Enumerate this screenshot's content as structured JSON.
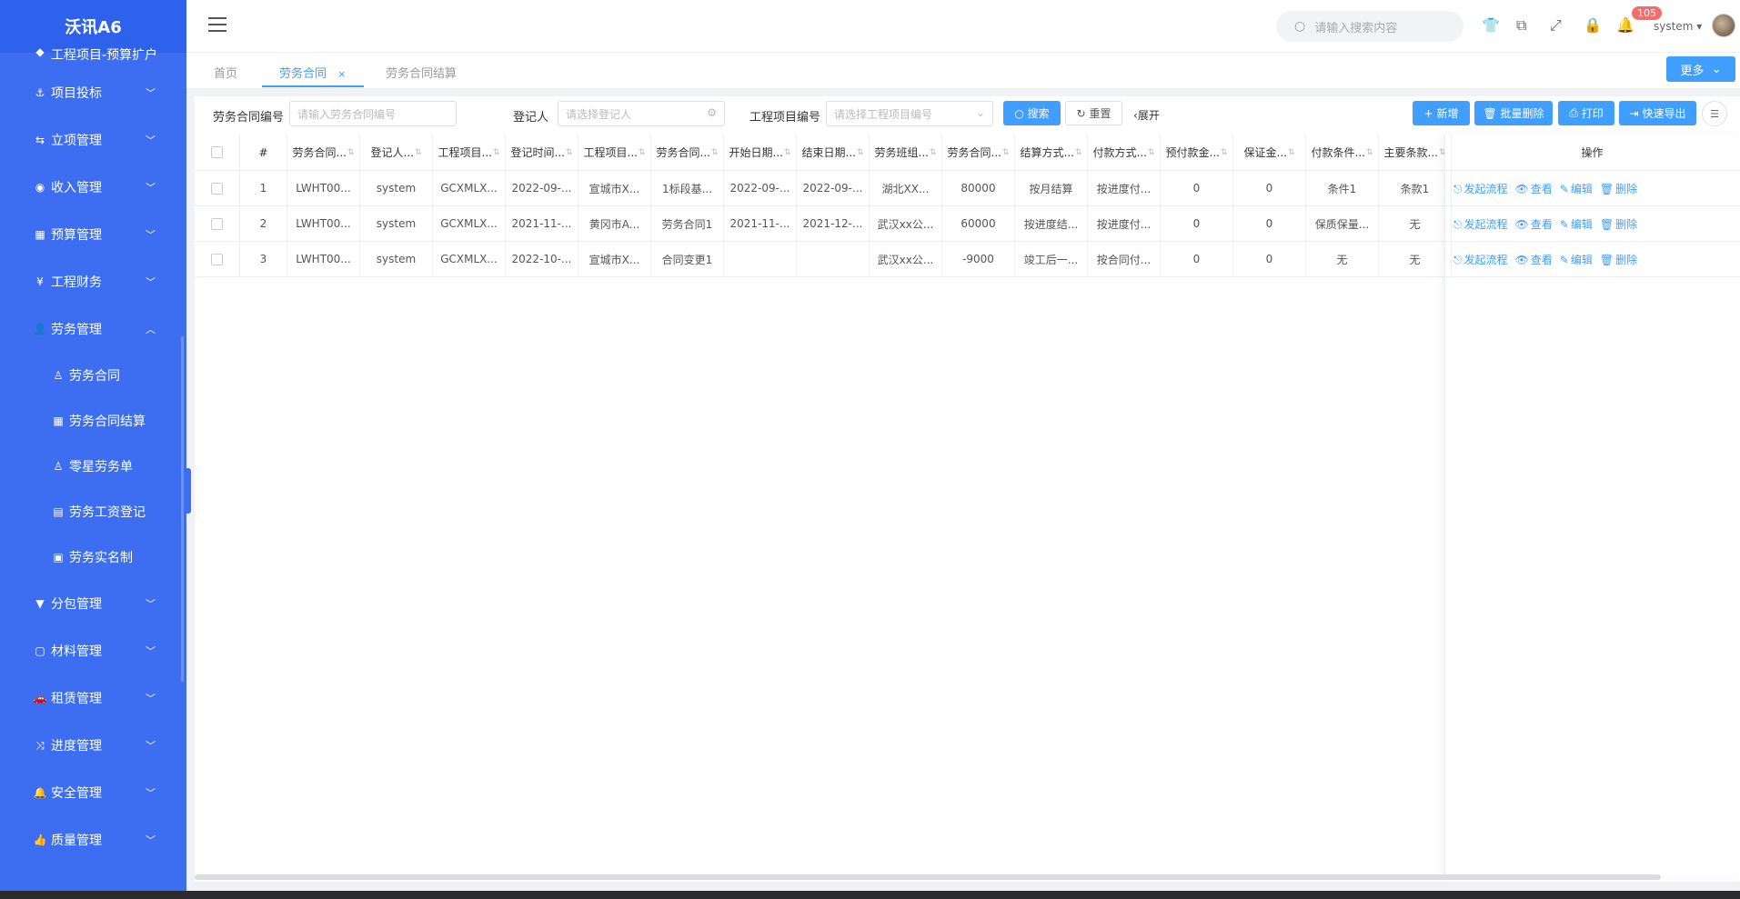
{
  "app": {
    "title": "沃讯A6"
  },
  "sidebar": {
    "cut_item": "工程项目-预算扩户",
    "items": [
      {
        "label": "项目投标",
        "icon": "anchor-icon",
        "glyph": "⚓"
      },
      {
        "label": "立项管理",
        "icon": "share-icon",
        "glyph": "⇆"
      },
      {
        "label": "收入管理",
        "icon": "compass-icon",
        "glyph": "◉"
      },
      {
        "label": "预算管理",
        "icon": "calculator-icon",
        "glyph": "▦"
      },
      {
        "label": "工程财务",
        "icon": "yen-icon",
        "glyph": "¥"
      },
      {
        "label": "劳务管理",
        "icon": "user-icon",
        "glyph": "👤"
      },
      {
        "label": "分包管理",
        "icon": "funnel-icon",
        "glyph": "▼"
      },
      {
        "label": "材料管理",
        "icon": "square-icon",
        "glyph": "▢"
      },
      {
        "label": "租赁管理",
        "icon": "car-icon",
        "glyph": "🚗"
      },
      {
        "label": "进度管理",
        "icon": "shuffle-icon",
        "glyph": "⤨"
      },
      {
        "label": "安全管理",
        "icon": "bell-icon",
        "glyph": "🔔"
      },
      {
        "label": "质量管理",
        "icon": "thumbs-up-icon",
        "glyph": "👍"
      }
    ],
    "sub_items": [
      {
        "label": "劳务合同",
        "icon": "user-outline-icon",
        "glyph": "♙"
      },
      {
        "label": "劳务合同结算",
        "icon": "calculator-icon",
        "glyph": "▦"
      },
      {
        "label": "零星劳务单",
        "icon": "user-outline-icon",
        "glyph": "♙"
      },
      {
        "label": "劳务工资登记",
        "icon": "file-icon",
        "glyph": "▤"
      },
      {
        "label": "劳务实名制",
        "icon": "id-card-icon",
        "glyph": "▣"
      }
    ]
  },
  "header": {
    "search_placeholder": "请输入搜索内容",
    "notification_count": "105",
    "username": "system"
  },
  "tabs": [
    {
      "label": "首页"
    },
    {
      "label": "劳务合同"
    },
    {
      "label": "劳务合同结算"
    }
  ],
  "more_label": "更多",
  "filters": {
    "contract_no_label": "劳务合同编号",
    "contract_no_placeholder": "请输入劳务合同编号",
    "registrant_label": "登记人",
    "registrant_placeholder": "请选择登记人",
    "project_no_label": "工程项目编号",
    "project_no_placeholder": "请选择工程项目编号",
    "search_label": "搜索",
    "reset_label": "重置",
    "expand_label": "展开"
  },
  "actions": {
    "add_label": "新增",
    "batch_delete_label": "批量删除",
    "print_label": "打印",
    "export_label": "快速导出"
  },
  "table": {
    "columns": [
      "#",
      "劳务合同...",
      "登记人...",
      "工程项目...",
      "登记时间...",
      "工程项目...",
      "劳务合同...",
      "开始日期...",
      "结束日期...",
      "劳务班组...",
      "劳务合同...",
      "结算方式...",
      "付款方式...",
      "预付款金...",
      "保证金...",
      "付款条件...",
      "主要条款..."
    ],
    "op_header": "操作",
    "op_labels": [
      "发起流程",
      "查看",
      "编辑",
      "删除"
    ],
    "rows": [
      [
        "1",
        "LWHT00...",
        "system",
        "GCXMLX...",
        "2022-09-...",
        "宣城市X...",
        "1标段基...",
        "2022-09-...",
        "2022-09-...",
        "湖北XX...",
        "80000",
        "按月结算",
        "按进度付...",
        "0",
        "0",
        "条件1",
        "条款1"
      ],
      [
        "2",
        "LWHT00...",
        "system",
        "GCXMLX...",
        "2021-11-...",
        "黄冈市A...",
        "劳务合同1",
        "2021-11-...",
        "2021-12-...",
        "武汉xx公...",
        "60000",
        "按进度结...",
        "按进度付...",
        "0",
        "0",
        "保质保量...",
        "无"
      ],
      [
        "3",
        "LWHT00...",
        "system",
        "GCXMLX...",
        "2022-10-...",
        "宣城市X...",
        "合同变更1",
        "",
        "",
        "武汉xx公...",
        "-9000",
        "竣工后一...",
        "按合同付...",
        "0",
        "0",
        "无",
        "无"
      ]
    ]
  }
}
